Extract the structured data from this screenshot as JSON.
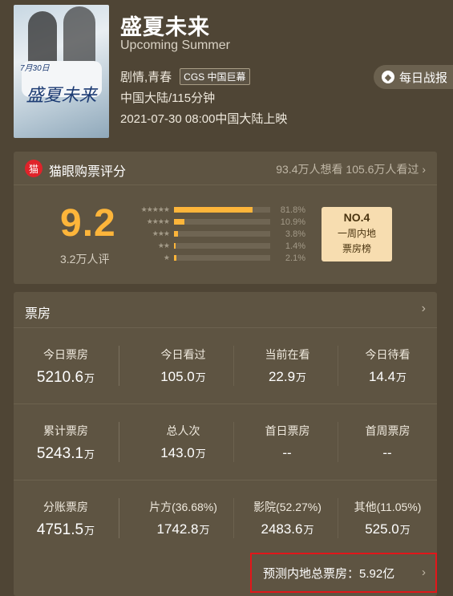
{
  "movie": {
    "title": "盛夏未来",
    "subtitle": "Upcoming Summer",
    "genres": "剧情,青春",
    "badge": "CGS 中国巨幕",
    "region_runtime": "中国大陆/115分钟",
    "release": "2021-07-30 08:00中国大陆上映",
    "poster_title": "盛夏未来",
    "poster_date": "7月30日"
  },
  "daily_report": {
    "label": "每日战报"
  },
  "rating": {
    "header_label": "猫眼购票评分",
    "stats": "93.4万人想看  105.6万人看过",
    "score": "9.2",
    "raters": "3.2万人评",
    "distribution": [
      {
        "stars": "★★★★★",
        "pct_label": "81.8%",
        "pct": 81.8
      },
      {
        "stars": "★★★★",
        "pct_label": "10.9%",
        "pct": 10.9
      },
      {
        "stars": "★★★",
        "pct_label": "3.8%",
        "pct": 3.8
      },
      {
        "stars": "★★",
        "pct_label": "1.4%",
        "pct": 1.4
      },
      {
        "stars": "★",
        "pct_label": "2.1%",
        "pct": 2.1
      }
    ],
    "rank": {
      "no": "NO.4",
      "line1": "一周内地",
      "line2": "票房榜"
    }
  },
  "boxoffice": {
    "title": "票房",
    "rows": [
      {
        "main": {
          "label": "今日票房",
          "value": "5210.6",
          "unit": "万"
        },
        "cells": [
          {
            "label": "今日看过",
            "value": "105.0",
            "unit": "万"
          },
          {
            "label": "当前在看",
            "value": "22.9",
            "unit": "万"
          },
          {
            "label": "今日待看",
            "value": "14.4",
            "unit": "万"
          }
        ]
      },
      {
        "main": {
          "label": "累计票房",
          "value": "5243.1",
          "unit": "万"
        },
        "cells": [
          {
            "label": "总人次",
            "value": "143.0",
            "unit": "万"
          },
          {
            "label": "首日票房",
            "value": "--",
            "unit": ""
          },
          {
            "label": "首周票房",
            "value": "--",
            "unit": ""
          }
        ]
      },
      {
        "main": {
          "label": "分账票房",
          "value": "4751.5",
          "unit": "万"
        },
        "cells": [
          {
            "label": "片方(36.68%)",
            "value": "1742.8",
            "unit": "万"
          },
          {
            "label": "影院(52.27%)",
            "value": "2483.6",
            "unit": "万"
          },
          {
            "label": "其他(11.05%)",
            "value": "525.0",
            "unit": "万"
          }
        ]
      }
    ],
    "forecast": "预测内地总票房：5.92亿"
  }
}
